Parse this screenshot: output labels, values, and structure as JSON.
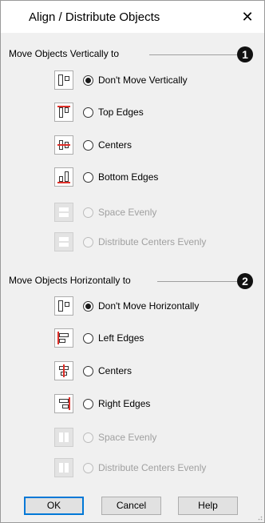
{
  "window": {
    "title": "Align / Distribute Objects",
    "close_glyph": "✕"
  },
  "vertical": {
    "header": "Move Objects Vertically to",
    "callout": "1",
    "options": [
      {
        "label": "Don't Move Vertically",
        "selected": true,
        "enabled": true,
        "icon": "dont-move-vertically-icon"
      },
      {
        "label": "Top Edges",
        "selected": false,
        "enabled": true,
        "icon": "top-edges-icon"
      },
      {
        "label": "Centers",
        "selected": false,
        "enabled": true,
        "icon": "vertical-centers-icon"
      },
      {
        "label": "Bottom Edges",
        "selected": false,
        "enabled": true,
        "icon": "bottom-edges-icon"
      },
      {
        "label": "Space Evenly",
        "selected": false,
        "enabled": false,
        "icon": "space-evenly-vertical-icon"
      },
      {
        "label": "Distribute Centers Evenly",
        "selected": false,
        "enabled": false,
        "icon": "distribute-centers-vertical-icon"
      }
    ]
  },
  "horizontal": {
    "header": "Move Objects Horizontally to",
    "callout": "2",
    "options": [
      {
        "label": "Don't Move Horizontally",
        "selected": true,
        "enabled": true,
        "icon": "dont-move-horizontally-icon"
      },
      {
        "label": "Left Edges",
        "selected": false,
        "enabled": true,
        "icon": "left-edges-icon"
      },
      {
        "label": "Centers",
        "selected": false,
        "enabled": true,
        "icon": "horizontal-centers-icon"
      },
      {
        "label": "Right Edges",
        "selected": false,
        "enabled": true,
        "icon": "right-edges-icon"
      },
      {
        "label": "Space Evenly",
        "selected": false,
        "enabled": false,
        "icon": "space-evenly-horizontal-icon"
      },
      {
        "label": "Distribute Centers Evenly",
        "selected": false,
        "enabled": false,
        "icon": "distribute-centers-horizontal-icon"
      }
    ]
  },
  "buttons": {
    "ok": "OK",
    "cancel": "Cancel",
    "help": "Help"
  },
  "colors": {
    "accent": "#0078d7",
    "align_line": "#e0302a",
    "shape_stroke": "#333333",
    "disabled_shape": "#ffffff"
  }
}
